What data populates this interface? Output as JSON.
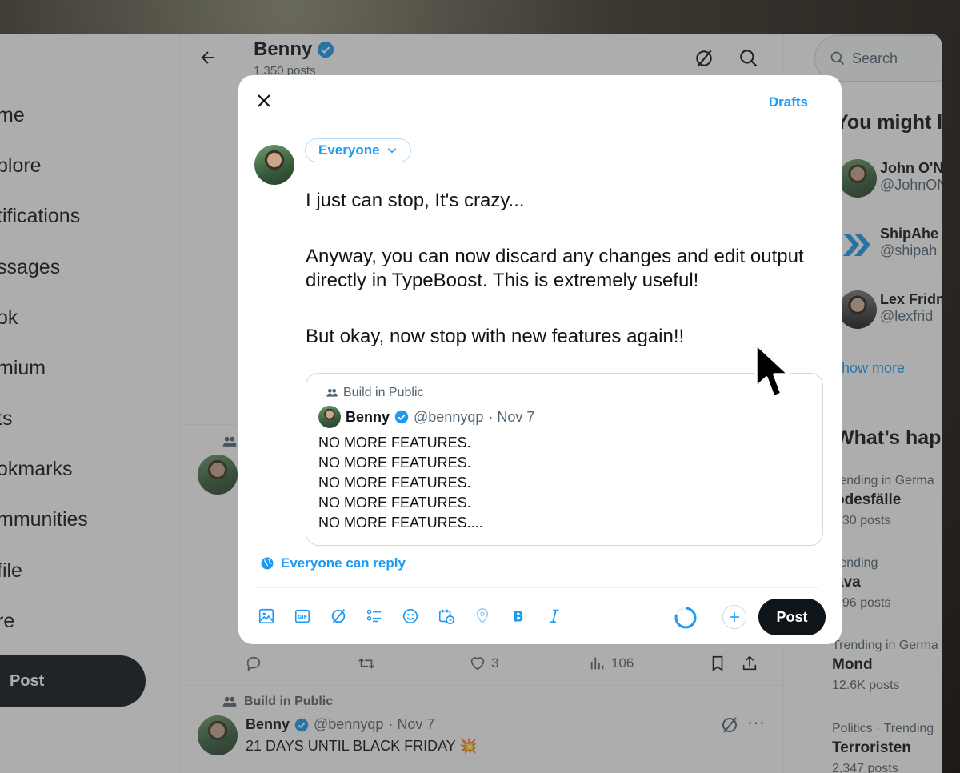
{
  "left_nav": {
    "items": [
      {
        "label": "me"
      },
      {
        "label": "plore"
      },
      {
        "label": "tifications"
      },
      {
        "label": "ssages"
      },
      {
        "label": "ok"
      },
      {
        "label": "mium"
      },
      {
        "label": "ts"
      },
      {
        "label": "okmarks"
      },
      {
        "label": "mmunities"
      },
      {
        "label": "file"
      },
      {
        "label": "re"
      }
    ],
    "post_label": "Post"
  },
  "profile_header": {
    "name": "Benny",
    "posts_count": "1,350 posts"
  },
  "feed": {
    "actions": {
      "likes": "3",
      "views": "106"
    },
    "tweet2": {
      "community": "Build in Public",
      "name": "Benny",
      "handle": "@bennyqp",
      "date": "· Nov 7",
      "text": "21 DAYS UNTIL BLACK FRIDAY 💥"
    }
  },
  "sidebar_right": {
    "search_placeholder": "Search",
    "might_like_title": "You might l",
    "suggestions": [
      {
        "name": "John O'N",
        "handle": "@JohnON"
      },
      {
        "name": "ShipAhe",
        "handle": "@shipah"
      },
      {
        "name": "Lex Fridm",
        "handle": "@lexfrid"
      }
    ],
    "show_more": "how more",
    "happening_title": "What’s hap",
    "trends": [
      {
        "context": "rending in Germa",
        "topic": "odesfälle",
        "posts": "330 posts"
      },
      {
        "context": "rending",
        "topic": "ava",
        "posts": "996 posts"
      },
      {
        "context": "Trending in Germa",
        "topic": "Mond",
        "posts": "12.6K posts"
      },
      {
        "context": "Politics · Trending",
        "topic": "Terroristen",
        "posts": "2,347 posts"
      }
    ]
  },
  "composer": {
    "drafts_label": "Drafts",
    "audience_label": "Everyone",
    "paragraphs": [
      "I just can stop, It's crazy...",
      "Anyway, you can now discard any changes and edit output directly in TypeBoost. This is extremely useful!",
      "But okay, now stop with new features again!!"
    ],
    "quote": {
      "community": "Build in Public",
      "name": "Benny",
      "handle": "@bennyqp",
      "date": "· Nov 7",
      "lines": [
        "NO MORE FEATURES.",
        "NO MORE FEATURES.",
        "NO MORE FEATURES.",
        "NO MORE FEATURES.",
        "NO MORE FEATURES...."
      ]
    },
    "reply_setting": "Everyone can reply",
    "post_label": "Post",
    "char_progress": 0.8
  },
  "colors": {
    "accent": "#1d9bf0",
    "text": "#0f1419",
    "muted": "#536471",
    "verified": "#1d9bf0"
  }
}
